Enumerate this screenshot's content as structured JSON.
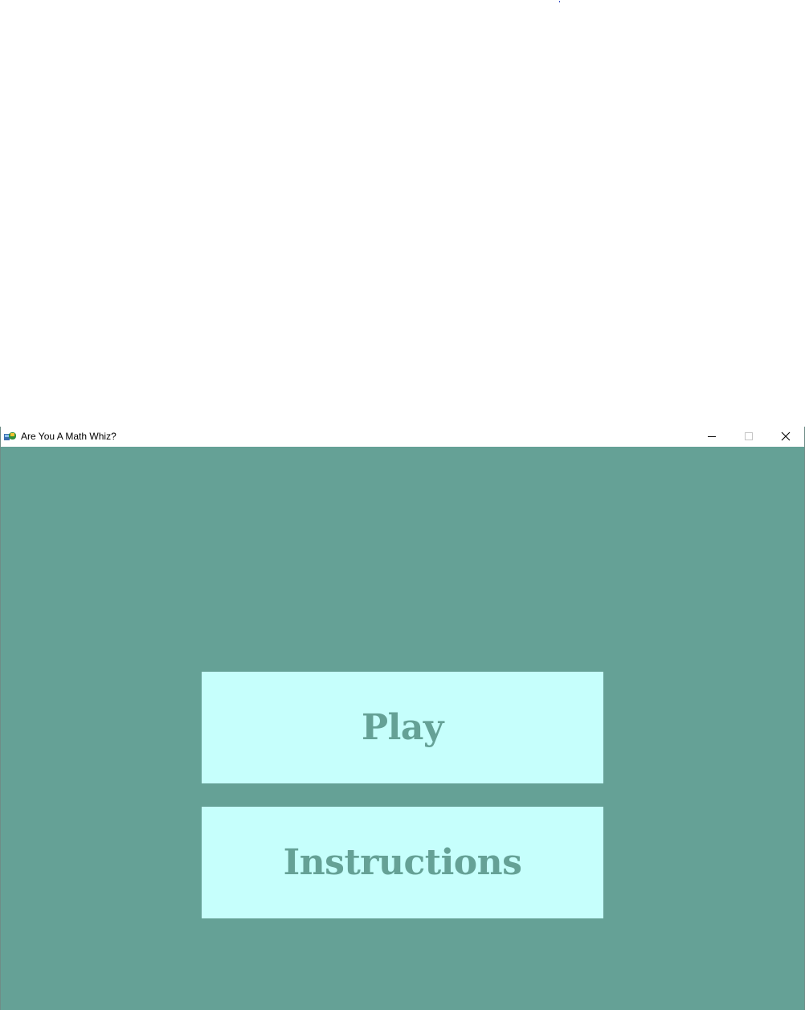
{
  "window": {
    "title": "Are You A Math Whiz?",
    "app_icon": "python-tk-icon",
    "controls": {
      "minimize": "minimize-icon",
      "maximize": "maximize-icon",
      "close": "close-icon"
    }
  },
  "menu": {
    "play_label": "Play",
    "instructions_label": "Instructions"
  },
  "colors": {
    "background": "#65a196",
    "button_fill": "#c6fffc",
    "button_text": "#65a196"
  }
}
